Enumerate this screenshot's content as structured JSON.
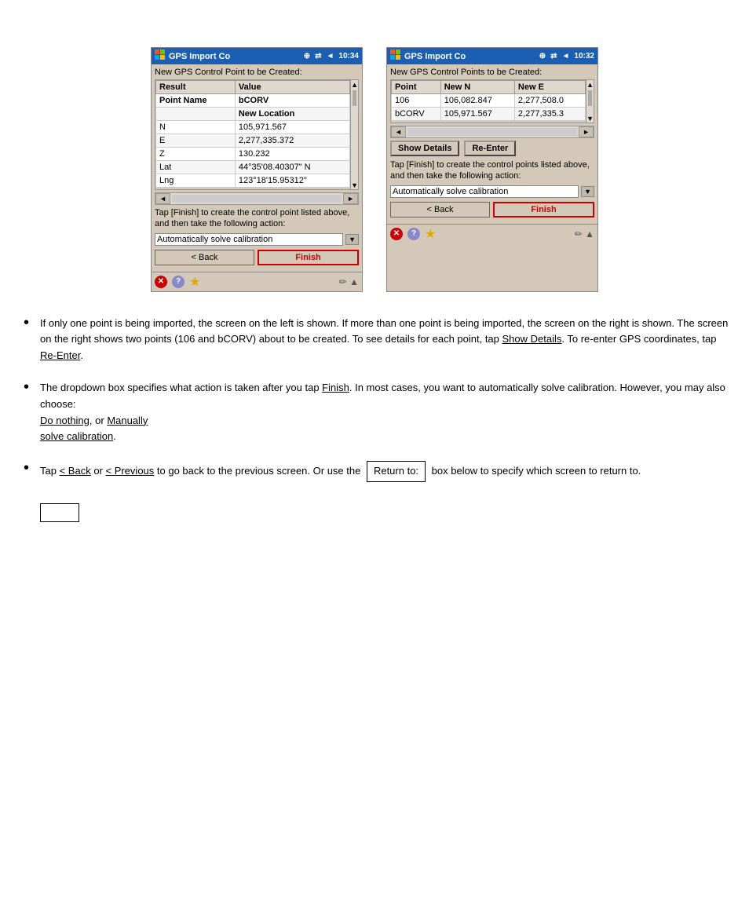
{
  "page": {
    "background": "#ffffff"
  },
  "left_device": {
    "titlebar": {
      "logo": "⊞",
      "title": "GPS Import Co",
      "icons": "⊕ ⇄ ◄ 10:34"
    },
    "subtitle": "New GPS Control Point to be Created:",
    "table_headers": [
      "Result",
      "Value"
    ],
    "table_rows": [
      [
        "Point Name",
        "bCORV"
      ],
      [
        "",
        "New Location"
      ],
      [
        "N",
        "105,971.567"
      ],
      [
        "E",
        "2,277,335.372"
      ],
      [
        "Z",
        "130.232"
      ],
      [
        "Lat",
        "44°35'08.40307\" N"
      ],
      [
        "Lng",
        "123°18'15.95312\""
      ]
    ],
    "tap_text": "Tap [Finish] to create the control point listed above, and then take the following action:",
    "dropdown_value": "Automatically solve calibration",
    "back_btn": "< Back",
    "finish_btn": "Finish"
  },
  "right_device": {
    "titlebar": {
      "logo": "⊞",
      "title": "GPS Import Co",
      "icons": "⊕ ⇄ ◄ 10:32"
    },
    "subtitle": "New GPS Control Points to be Created:",
    "table_headers": [
      "Point",
      "New N",
      "New E"
    ],
    "table_rows": [
      [
        "106",
        "106,082.847",
        "2,277,508.0"
      ],
      [
        "bCORV",
        "105,971.567",
        "2,277,335.3"
      ]
    ],
    "show_details_btn": "Show Details",
    "re_enter_btn": "Re-Enter",
    "tap_text": "Tap [Finish] to create the control points listed above, and then take the following action:",
    "dropdown_value": "Automatically solve calibration",
    "back_btn": "< Back",
    "finish_btn": "Finish"
  },
  "bullets": [
    {
      "id": "bullet1",
      "text_parts": [
        {
          "text": "If only one point is being imported, the screen on the left is shown. If more than one point is being imported, the screen on the right is shown. The screen on the right shows two points (106 and bCORV) about to be created. To see details for each point, tap ",
          "underline": false
        },
        {
          "text": "Show Details",
          "underline": true
        },
        {
          "text": ". To re-enter GPS coordinates, tap ",
          "underline": false
        },
        {
          "text": "Re-Enter",
          "underline": true
        },
        {
          "text": ".",
          "underline": false
        }
      ]
    },
    {
      "id": "bullet2",
      "text_parts": [
        {
          "text": "The dropdown box specifies what action is taken after you tap ",
          "underline": false
        },
        {
          "text": "Finish",
          "underline": true
        },
        {
          "text": ". In most cases, you want to automatically solve calibration. However, you may also choose:",
          "underline": false
        },
        {
          "text": "\nDo nothing",
          "underline": true
        },
        {
          "text": ", or ",
          "underline": false
        },
        {
          "text": "Manually",
          "underline": true
        },
        {
          "text": "\n",
          "underline": false
        },
        {
          "text": "solve calibration",
          "underline": true
        },
        {
          "text": ".",
          "underline": false
        }
      ]
    },
    {
      "id": "bullet3",
      "text_parts": [
        {
          "text": "Tap ",
          "underline": false
        },
        {
          "text": "< Back",
          "underline": true
        },
        {
          "text": " or ",
          "underline": false
        },
        {
          "text": "< Previous",
          "underline": true
        },
        {
          "text": " to go back to the previous screen. Or use the ",
          "underline": false
        },
        {
          "text": "inline_box_label",
          "underline": false
        },
        {
          "text": " box below to specify which screen to return to.",
          "underline": false
        }
      ],
      "inline_box": "Return to:",
      "small_box_label": ""
    }
  ],
  "inline_box_text": "Return to:",
  "small_box_placeholder": ""
}
